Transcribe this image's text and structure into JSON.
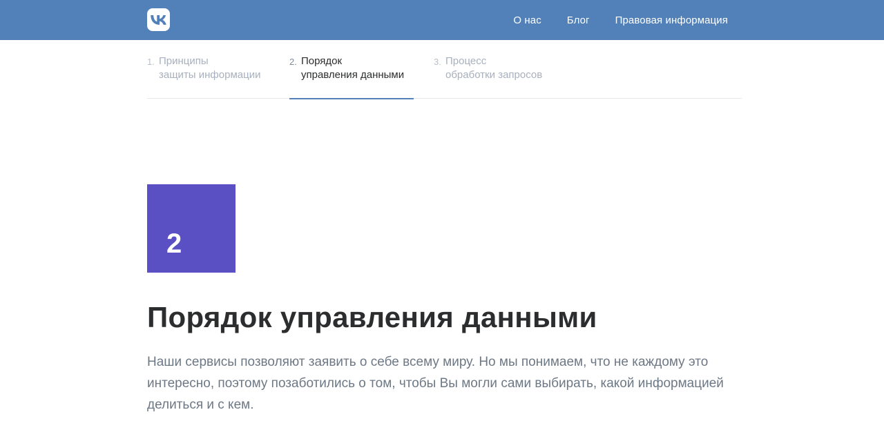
{
  "header": {
    "nav": [
      "О нас",
      "Блог",
      "Правовая информация"
    ]
  },
  "steps": [
    {
      "num": "1.",
      "label": "Принципы\nзащиты информации"
    },
    {
      "num": "2.",
      "label": "Порядок\nуправления данными"
    },
    {
      "num": "3.",
      "label": "Процесс\nобработки запросов"
    }
  ],
  "section": {
    "number": "2",
    "title": "Порядок управления данными",
    "text": "Наши сервисы позволяют заявить о себе всему миру. Но мы понимаем, что не каждому это интересно, поэтому позаботились о том, чтобы Вы могли сами выбирать, какой информацией делиться и с кем."
  },
  "colors": {
    "header": "#5181b8",
    "badge": "#5b4fc4",
    "accent": "#5181b8"
  },
  "icons": {
    "logo": "vk-logo-icon"
  }
}
